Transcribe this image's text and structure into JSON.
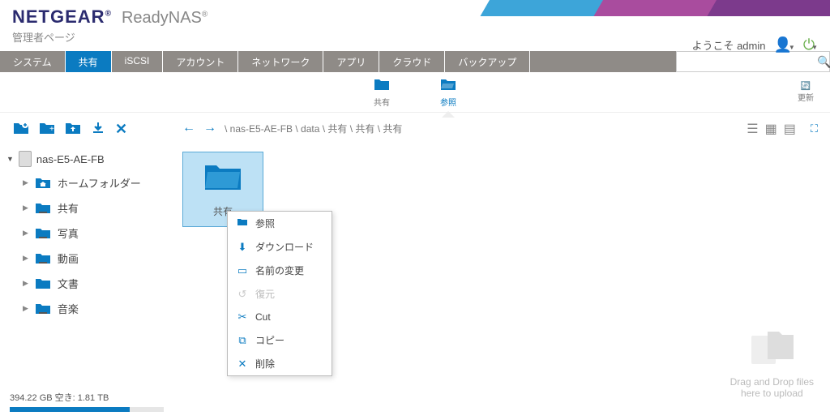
{
  "brand": {
    "logo": "NETGEAR",
    "product": "ReadyNAS",
    "subtitle": "管理者ページ"
  },
  "user": {
    "welcome": "ようこそ admin"
  },
  "tabs": {
    "system": "システム",
    "shares": "共有",
    "iscsi": "iSCSI",
    "accounts": "アカウント",
    "network": "ネットワーク",
    "apps": "アプリ",
    "cloud": "クラウド",
    "backup": "バックアップ"
  },
  "subbar": {
    "share": "共有",
    "browse": "参照",
    "refresh": "更新"
  },
  "tree": {
    "root": "nas-E5-AE-FB",
    "items": {
      "home": "ホームフォルダー",
      "share": "共有",
      "photo": "写真",
      "video": "動画",
      "document": "文書",
      "music": "音楽"
    }
  },
  "breadcrumb": "\\ nas-E5-AE-FB \\ data \\ 共有 \\ 共有 \\ 共有",
  "folder": {
    "name": "共有"
  },
  "ctx": {
    "browse": "参照",
    "download": "ダウンロード",
    "rename": "名前の変更",
    "restore": "復元",
    "cut": "Cut",
    "copy": "コピー",
    "delete": "削除"
  },
  "dropzone": {
    "line1": "Drag and Drop files",
    "line2": "here to upload"
  },
  "storage": {
    "text": "394.22 GB 空き: 1.81 TB",
    "percent": 78
  }
}
